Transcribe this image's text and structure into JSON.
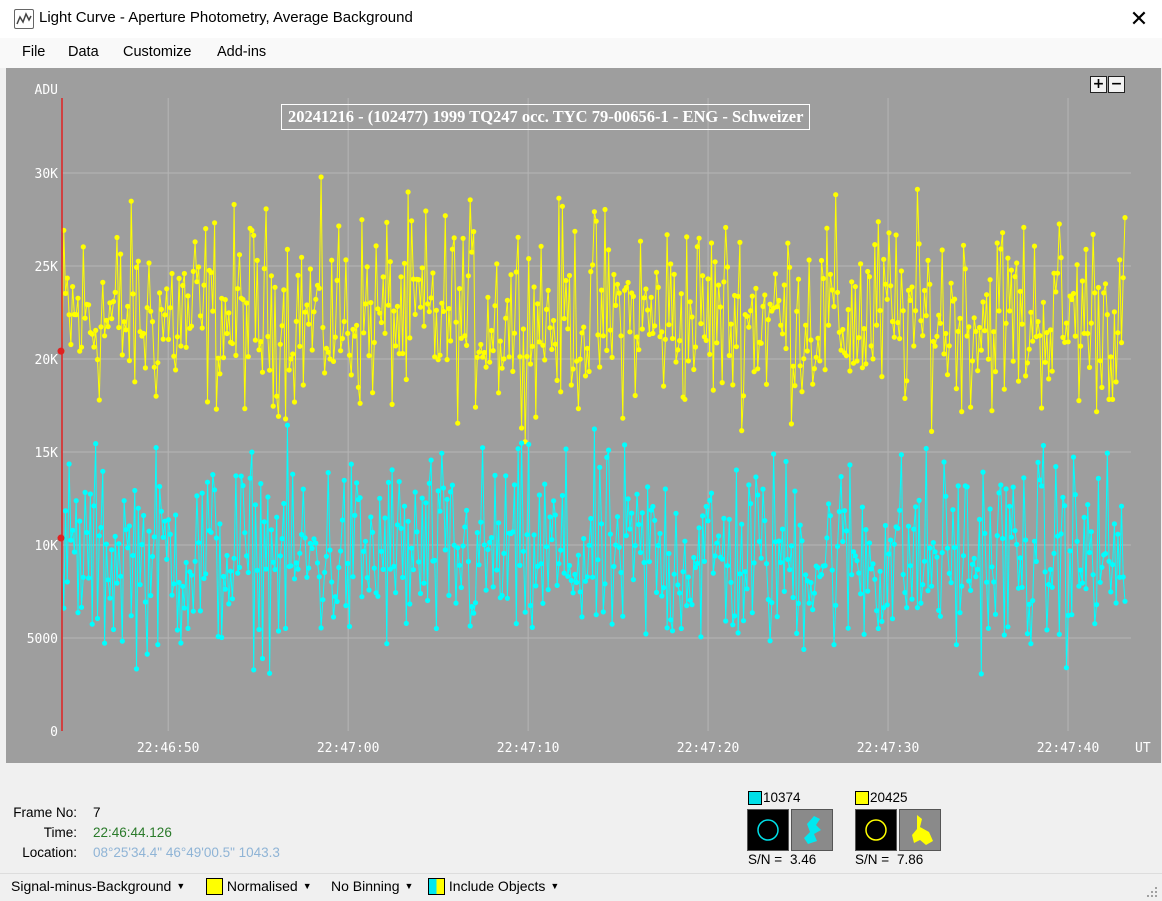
{
  "window": {
    "title": "Light Curve - Aperture Photometry, Average Background",
    "close_symbol": "✕"
  },
  "menu": [
    "File",
    "Data",
    "Customize",
    "Add-ins"
  ],
  "chart": {
    "title": "20241216 - (102477) 1999 TQ247 occ. TYC 79-00656-1 - ENG - Schweizer",
    "zoom_in": "+",
    "zoom_out": "−",
    "background_color": "#9e9e9e",
    "grid_color": "#b5b5b5",
    "cursor_color": "#e02020"
  },
  "chart_data": {
    "type": "line",
    "title": "20241216 - (102477) 1999 TQ247 occ. TYC 79-00656-1 - ENG - Schweizer",
    "ylabel": "ADU",
    "xlabel": "UT",
    "ylim": [
      0,
      35000
    ],
    "yticks": [
      0,
      5000,
      10000,
      15000,
      20000,
      25000,
      30000
    ],
    "ytick_labels": [
      "0",
      "5000",
      "10K",
      "15K",
      "20K",
      "25K",
      "30K"
    ],
    "xticks": [
      "22:46:50",
      "22:47:00",
      "22:47:10",
      "22:47:20",
      "22:47:30",
      "22:47:40"
    ],
    "xlim": [
      "22:46:44.1",
      "22:47:43.5"
    ],
    "grid": true,
    "series": [
      {
        "name": "20425",
        "color": "#ffff00",
        "mean": 22000,
        "range": [
          15200,
          30700
        ]
      },
      {
        "name": "10374",
        "color": "#00ffff",
        "mean": 9200,
        "range": [
          1900,
          17600
        ]
      }
    ],
    "cursor_time": "22:46:44.126",
    "cursor_values": [
      20425,
      10374
    ]
  },
  "info": {
    "frame_label": "Frame No:",
    "frame_value": "7",
    "time_label": "Time:",
    "time_value": "22:46:44.126",
    "location_label": "Location:",
    "location_value": "08°25'34.4\" 46°49'00.5\" 1043.3"
  },
  "objects": [
    {
      "id": "10374",
      "color": "#00e0e8",
      "sn_label": "S/N =",
      "sn_value": "3.46"
    },
    {
      "id": "20425",
      "color": "#ffff00",
      "sn_label": "S/N =",
      "sn_value": "7.86"
    }
  ],
  "statusbar": {
    "signal": "Signal-minus-Background",
    "normalised": "Normalised",
    "binning": "No Binning",
    "include": "Include Objects"
  }
}
